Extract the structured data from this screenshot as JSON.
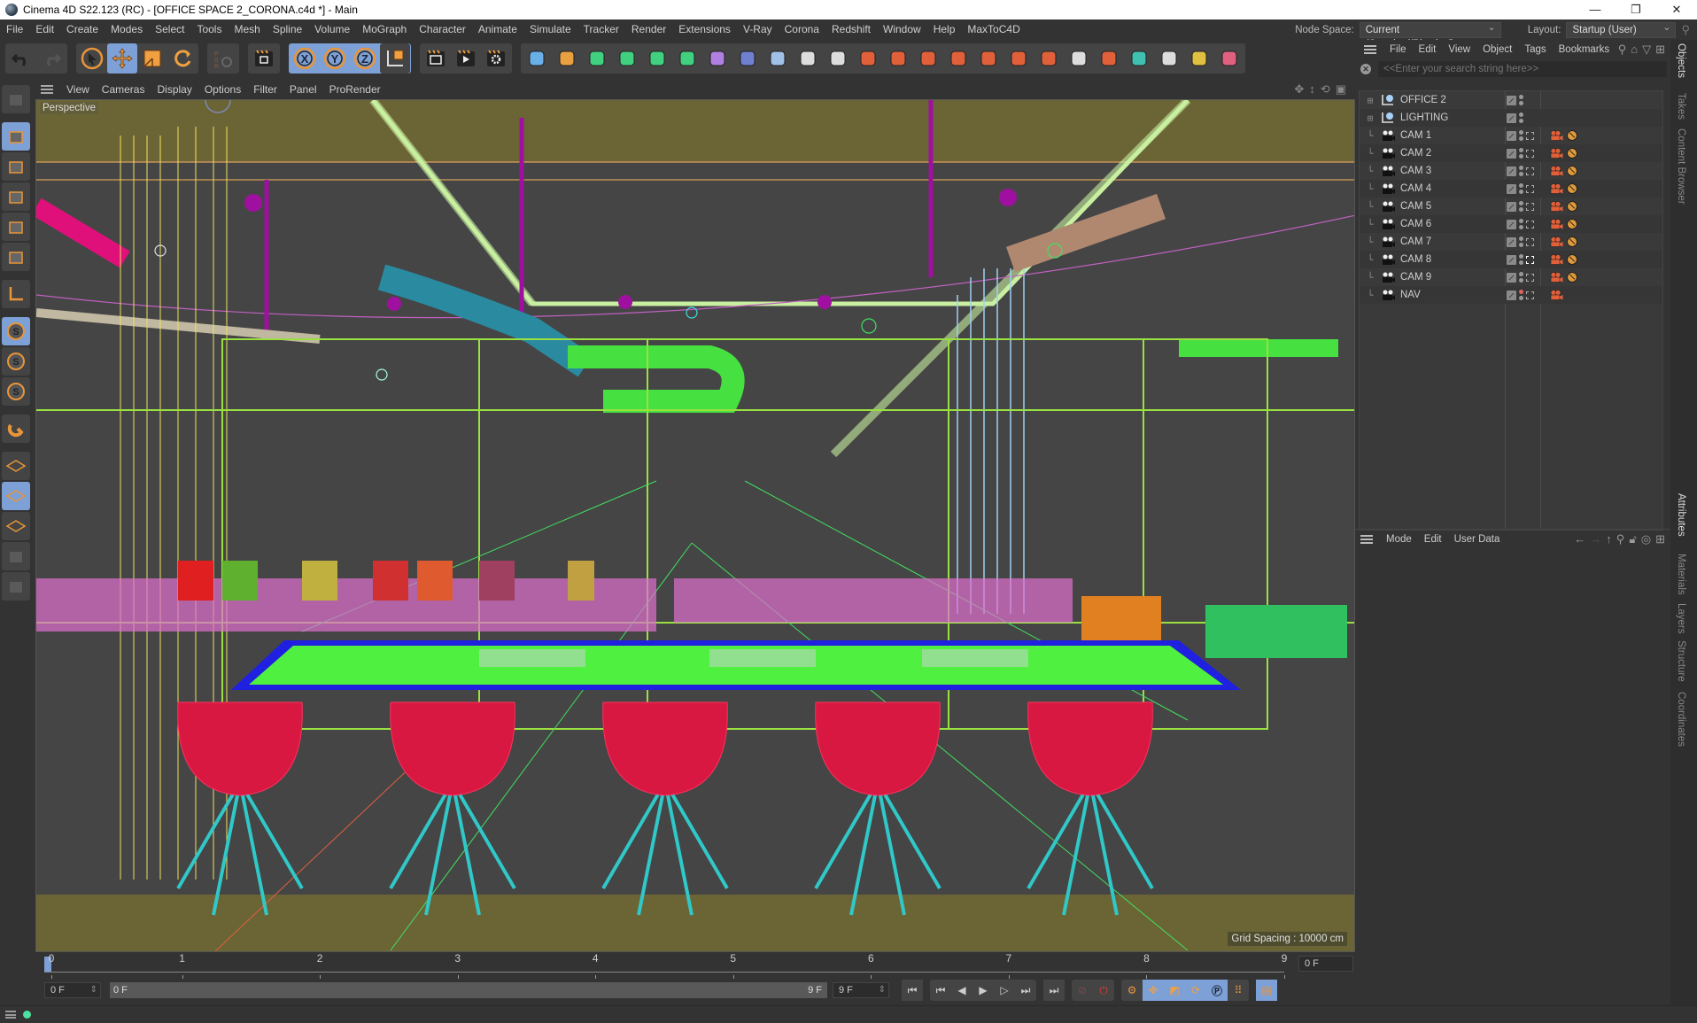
{
  "window": {
    "title": "Cinema 4D S22.123 (RC) - [OFFICE SPACE 2_CORONA.c4d *] - Main",
    "controls": [
      "—",
      "❐",
      "✕"
    ]
  },
  "menubar": {
    "items": [
      "File",
      "Edit",
      "Create",
      "Modes",
      "Select",
      "Tools",
      "Mesh",
      "Spline",
      "Volume",
      "MoGraph",
      "Character",
      "Animate",
      "Simulate",
      "Tracker",
      "Render",
      "Extensions",
      "V-Ray",
      "Corona",
      "Redshift",
      "Window",
      "Help",
      "MaxToC4D"
    ],
    "node_space_label": "Node Space:",
    "node_space_value": "Current (Standard/Physical)",
    "layout_label": "Layout:",
    "layout_value": "Startup (User)"
  },
  "toolbar": {
    "groups": [
      [
        "undo-icon",
        "redo-icon"
      ],
      [
        "select-icon",
        "move-icon",
        "scale-icon",
        "rotate-icon"
      ],
      [
        "psr-icon"
      ],
      [
        "render-region-icon"
      ],
      [
        "x-axis-icon",
        "y-axis-icon",
        "z-axis-icon",
        "coordinate-system-icon"
      ],
      [
        "render-view-icon",
        "render-picture-viewer-icon",
        "render-settings-icon"
      ],
      [
        "cube-icon",
        "pen-icon",
        "subdivision-icon",
        "extrude-icon",
        "cloner-icon",
        "mograph-icon",
        "deformer-icon",
        "field-icon",
        "floor-icon",
        "camera-icon",
        "light-icon",
        "redshift-ipr-icon",
        "redshift-renderview-icon",
        "redshift-camera-icon",
        "redshift-environment-icon",
        "redshift-sun-icon",
        "redshift-proxy-icon",
        "redshift-object-icon",
        "redshift-dome-icon",
        "redshift-material-icon",
        "redshift-scatter-icon",
        "redshift-import-icon",
        "redshift-colors-icon",
        "redshift-texture-icon"
      ]
    ]
  },
  "left_tools": [
    "make-editable-icon",
    "model-mode-icon",
    "texture-mode-icon",
    "points-mode-icon",
    "edges-mode-icon",
    "polygons-mode-icon",
    "axis-mode-icon",
    "solo-off-icon",
    "solo-single-icon",
    "solo-hierarchy-icon",
    "snap-icon",
    "workplane-icon",
    "locked-workplane-icon",
    "workplane-align-icon",
    "magnet-icon",
    "floor-snap-icon"
  ],
  "viewport": {
    "menu": [
      "View",
      "Cameras",
      "Display",
      "Options",
      "Filter",
      "Panel",
      "ProRender"
    ],
    "label": "Perspective",
    "grid_spacing": "Grid Spacing : 10000 cm"
  },
  "timeline": {
    "ticks": [
      "0",
      "1",
      "2",
      "3",
      "4",
      "5",
      "6",
      "7",
      "8",
      "9"
    ],
    "current_frame": "0 F",
    "end_frame_field": "0 F",
    "start_field": "0 F",
    "range_start": "0 F",
    "range_end": "9 F",
    "end_field": "9 F"
  },
  "transport": {
    "buttons": [
      "go-to-start-icon",
      "previous-key-icon",
      "previous-frame-icon",
      "play-icon",
      "next-frame-icon",
      "next-key-icon",
      "go-to-end-icon"
    ]
  },
  "object_manager": {
    "menu": [
      "File",
      "Edit",
      "View",
      "Object",
      "Tags",
      "Bookmarks"
    ],
    "search_placeholder": "<<Enter your search string here>>",
    "objects": [
      {
        "name": "OFFICE 2",
        "type": "layer",
        "expandable": true,
        "dot_top": "grey",
        "has_tags": false
      },
      {
        "name": "LIGHTING",
        "type": "layer",
        "expandable": true,
        "dot_top": "grey",
        "has_tags": false
      },
      {
        "name": "CAM 1",
        "type": "camera",
        "dot_top": "grey",
        "has_tags": true,
        "protect": true
      },
      {
        "name": "CAM 2",
        "type": "camera",
        "dot_top": "grey",
        "has_tags": true,
        "protect": true
      },
      {
        "name": "CAM 3",
        "type": "camera",
        "dot_top": "grey",
        "has_tags": true,
        "protect": true
      },
      {
        "name": "CAM 4",
        "type": "camera",
        "dot_top": "grey",
        "has_tags": true,
        "protect": true
      },
      {
        "name": "CAM 5",
        "type": "camera",
        "dot_top": "grey",
        "has_tags": true,
        "protect": true
      },
      {
        "name": "CAM 6",
        "type": "camera",
        "dot_top": "grey",
        "has_tags": true,
        "protect": true
      },
      {
        "name": "CAM 7",
        "type": "camera",
        "dot_top": "grey",
        "has_tags": true,
        "protect": true
      },
      {
        "name": "CAM 8",
        "type": "camera",
        "dot_top": "grey",
        "has_tags": true,
        "protect": true,
        "active_camera": true
      },
      {
        "name": "CAM 9",
        "type": "camera",
        "dot_top": "grey",
        "has_tags": true,
        "protect": true
      },
      {
        "name": "NAV",
        "type": "camera",
        "dot_top": "red",
        "has_tags": true,
        "protect": false
      }
    ]
  },
  "attributes": {
    "menu": [
      "Mode",
      "Edit",
      "User Data"
    ]
  },
  "side_tabs_top": [
    "Objects",
    "Takes",
    "Content Browser"
  ],
  "side_tabs_bottom": [
    "Attributes",
    "Materials",
    "Layers",
    "Structure",
    "Coordinates"
  ],
  "colors": {
    "accent": "#7da0d6",
    "viewport_bg": "#454545",
    "ceiling_band": "#6b6536",
    "redshift_orange": "#e0603a"
  }
}
